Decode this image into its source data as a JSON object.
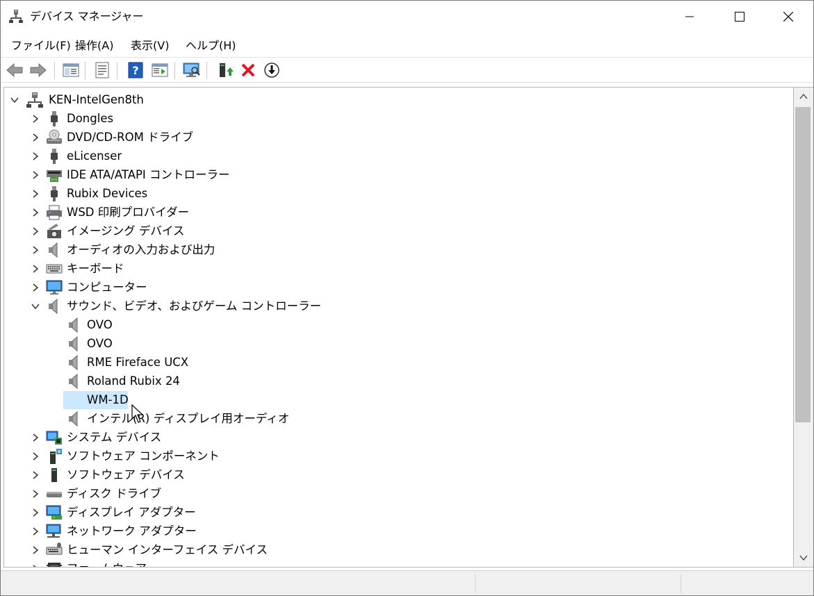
{
  "window": {
    "title": "デバイス マネージャー"
  },
  "menu": [
    {
      "label": "ファイル(F)"
    },
    {
      "label": "操作(A)"
    },
    {
      "label": "表示(V)"
    },
    {
      "label": "ヘルプ(H)"
    }
  ],
  "toolbar": {
    "icons": [
      "back-icon",
      "forward-icon",
      "show-hide-console-tree-icon",
      "properties-icon",
      "help-icon",
      "action-pane-icon",
      "scan-hardware-icon",
      "update-driver-icon",
      "uninstall-device-icon",
      "disable-device-icon"
    ]
  },
  "tree": {
    "root": "KEN-IntelGen8th",
    "categories": [
      {
        "label": "Dongles",
        "icon": "usb-icon"
      },
      {
        "label": "DVD/CD-ROM ドライブ",
        "icon": "dvd-drive-icon"
      },
      {
        "label": "eLicenser",
        "icon": "usb-icon"
      },
      {
        "label": "IDE ATA/ATAPI コントローラー",
        "icon": "ide-controller-icon"
      },
      {
        "label": "Rubix Devices",
        "icon": "usb-icon"
      },
      {
        "label": "WSD 印刷プロバイダー",
        "icon": "printer-icon"
      },
      {
        "label": "イメージング デバイス",
        "icon": "camera-icon"
      },
      {
        "label": "オーディオの入力および出力",
        "icon": "speaker-icon"
      },
      {
        "label": "キーボード",
        "icon": "keyboard-icon"
      },
      {
        "label": "コンピューター",
        "icon": "monitor-icon"
      },
      {
        "label": "サウンド、ビデオ、およびゲーム コントローラー",
        "icon": "speaker-icon",
        "expanded": true
      }
    ],
    "sound_children": [
      {
        "label": "OVO"
      },
      {
        "label": "OVO"
      },
      {
        "label": "RME Fireface UCX"
      },
      {
        "label": "Roland Rubix 24"
      },
      {
        "label": "WM-1D",
        "selected": true
      },
      {
        "label": "インテル(R) ディスプレイ用オーディオ"
      }
    ],
    "more_categories": [
      {
        "label": "システム デバイス",
        "icon": "system-device-icon"
      },
      {
        "label": "ソフトウェア コンポーネント",
        "icon": "software-component-icon"
      },
      {
        "label": "ソフトウェア デバイス",
        "icon": "software-device-icon"
      },
      {
        "label": "ディスク ドライブ",
        "icon": "disk-drive-icon"
      },
      {
        "label": "ディスプレイ アダプター",
        "icon": "display-adapter-icon"
      },
      {
        "label": "ネットワーク アダプター",
        "icon": "network-adapter-icon"
      },
      {
        "label": "ヒューマン インターフェイス デバイス",
        "icon": "hid-icon"
      },
      {
        "label": "ファームウェア",
        "icon": "firmware-icon"
      }
    ]
  },
  "colors": {
    "selection": "#cce8ff",
    "uninstall_red": "#e81123",
    "help_blue": "#1f5fbf"
  }
}
